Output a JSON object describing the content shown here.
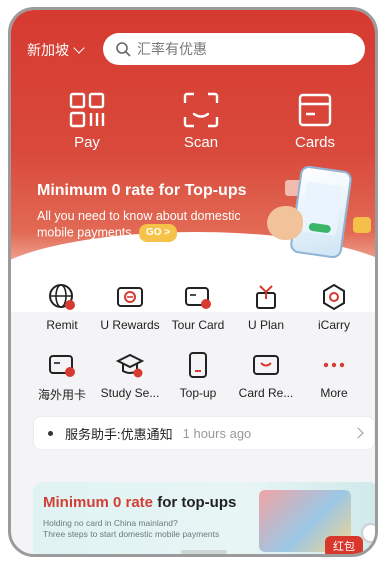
{
  "header": {
    "city": "新加坡",
    "search_placeholder": "汇率有优惠"
  },
  "quick_actions": [
    {
      "label": "Pay",
      "icon": "qr-grid-icon"
    },
    {
      "label": "Scan",
      "icon": "scan-frame-icon"
    },
    {
      "label": "Cards",
      "icon": "card-icon"
    }
  ],
  "banner": {
    "title": "Minimum 0 rate for Top-ups",
    "subtitle": "All you need to know about domestic mobile payments",
    "cta": "GO >"
  },
  "services": [
    {
      "label": "Remit",
      "icon": "globe-icon"
    },
    {
      "label": "U Rewards",
      "icon": "rewards-card-icon"
    },
    {
      "label": "Tour Card",
      "icon": "tour-card-icon"
    },
    {
      "label": "U Plan",
      "icon": "gift-icon"
    },
    {
      "label": "iCarry",
      "icon": "icarry-icon"
    },
    {
      "label": "海外用卡",
      "icon": "overseas-card-icon"
    },
    {
      "label": "Study Se...",
      "icon": "graduation-cap-icon"
    },
    {
      "label": "Top-up",
      "icon": "topup-phone-icon"
    },
    {
      "label": "Card Re...",
      "icon": "card-repay-icon"
    },
    {
      "label": "More",
      "icon": "more-dots-icon"
    }
  ],
  "notice": {
    "text": "服务助手:优惠通知",
    "time": "1 hours ago"
  },
  "promo": {
    "title_red": "Minimum 0 rate",
    "title_black": " for top-ups",
    "line1": "Holding no card in China mainland?",
    "line2": "Three steps to start domestic mobile payments"
  },
  "floating": {
    "red_packet": "红包"
  },
  "colors": {
    "brand_red": "#d63a30",
    "accent_yellow": "#f6c34a"
  }
}
